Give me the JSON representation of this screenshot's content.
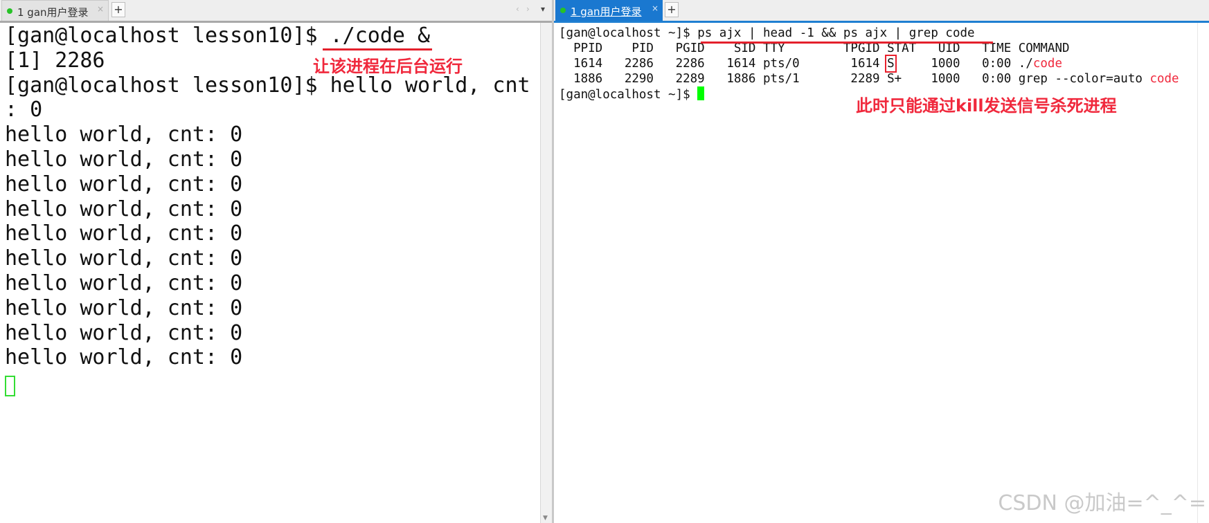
{
  "left_tab": {
    "label": "1 gan用户登录",
    "close": "×"
  },
  "right_tab": {
    "label": "1 gan用户登录",
    "close": "×"
  },
  "new_tab": "+",
  "tab_nav": {
    "prev": "‹",
    "next": "›",
    "menu": "▾"
  },
  "left_terminal": {
    "line1_prompt": "[gan@localhost lesson10]$ ",
    "line1_cmd": "./code &",
    "line2": "[1] 2286",
    "line3": "[gan@localhost lesson10]$ hello world, cnt",
    "line4": ": 0",
    "output": [
      "hello world, cnt: 0",
      "hello world, cnt: 0",
      "hello world, cnt: 0",
      "hello world, cnt: 0",
      "hello world, cnt: 0",
      "hello world, cnt: 0",
      "hello world, cnt: 0",
      "hello world, cnt: 0",
      "hello world, cnt: 0",
      "hello world, cnt: 0"
    ]
  },
  "left_annotation": "让该进程在后台运行",
  "right_terminal": {
    "prompt": "[gan@localhost ~]$ ",
    "command": "ps ajx | head -1 && ps ajx | grep code",
    "header": "  PPID    PID   PGID    SID TTY        TPGID STAT   UID   TIME COMMAND",
    "rows": [
      {
        "pre": "  1614   2286   2286   1614 pts/0       1614 ",
        "stat": "S",
        "mid": "     1000   0:00 ./",
        "cmd_red": "code"
      },
      {
        "pre": "  1886   2290   2289   1886 pts/1       2289 ",
        "stat": "S+",
        "mid": "    1000   0:00 grep --color=auto ",
        "cmd_red": "code"
      }
    ],
    "final_prompt": "[gan@localhost ~]$ "
  },
  "right_annotation": "此时只能通过kill发送信号杀死进程",
  "watermark": "CSDN @加油=^_^=",
  "colors": {
    "annotation_red": "#f0283c",
    "cursor_green": "#00ff00",
    "active_tab_blue": "#1a78d0"
  }
}
